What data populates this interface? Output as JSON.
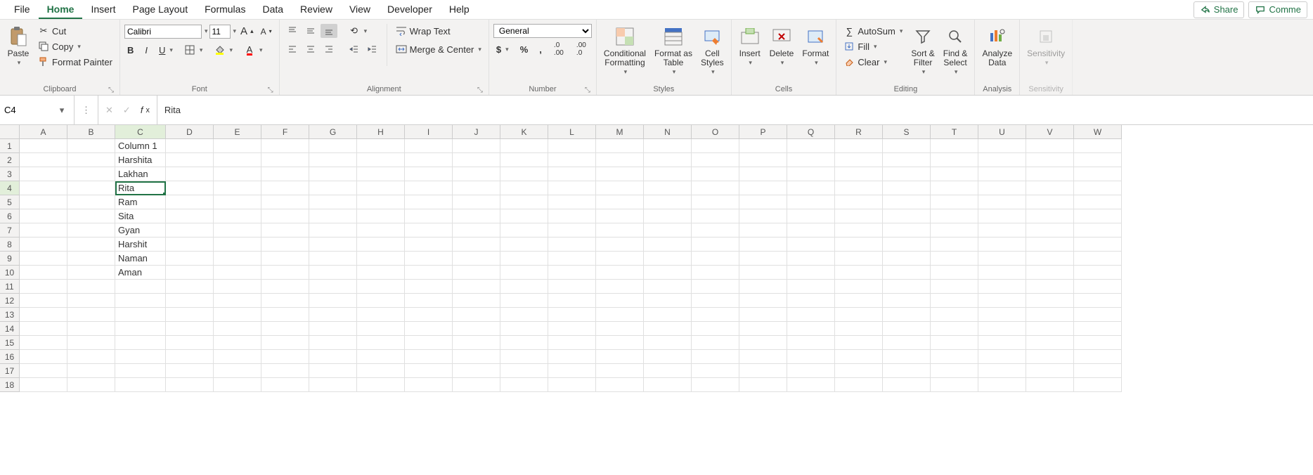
{
  "tabs": [
    "File",
    "Home",
    "Insert",
    "Page Layout",
    "Formulas",
    "Data",
    "Review",
    "View",
    "Developer",
    "Help"
  ],
  "active_tab": "Home",
  "share": "Share",
  "comments": "Comme",
  "clipboard": {
    "label": "Clipboard",
    "paste": "Paste",
    "cut": "Cut",
    "copy": "Copy",
    "fmt": "Format Painter"
  },
  "font": {
    "label": "Font",
    "name": "Calibri",
    "size": "11"
  },
  "alignment": {
    "label": "Alignment",
    "wrap": "Wrap Text",
    "merge": "Merge & Center"
  },
  "number": {
    "label": "Number",
    "format": "General"
  },
  "styles": {
    "label": "Styles",
    "cond": "Conditional\nFormatting",
    "table": "Format as\nTable",
    "cell": "Cell\nStyles"
  },
  "cells_grp": {
    "label": "Cells",
    "insert": "Insert",
    "delete": "Delete",
    "format": "Format"
  },
  "editing": {
    "label": "Editing",
    "sum": "AutoSum",
    "fill": "Fill",
    "clear": "Clear",
    "sort": "Sort &\nFilter",
    "find": "Find &\nSelect"
  },
  "analysis": {
    "label": "Analysis",
    "analyze": "Analyze\nData"
  },
  "sensitivity": {
    "label": "Sensitivity",
    "btn": "Sensitivity"
  },
  "namebox": "C4",
  "formula": "Rita",
  "columns": [
    "A",
    "B",
    "C",
    "D",
    "E",
    "F",
    "G",
    "H",
    "I",
    "J",
    "K",
    "L",
    "M",
    "N",
    "O",
    "P",
    "Q",
    "R",
    "S",
    "T",
    "U",
    "V",
    "W"
  ],
  "rowcount": 18,
  "selected": {
    "row": 4,
    "col": "C"
  },
  "cells_data": {
    "C1": "Column 1",
    "C2": "Harshita",
    "C3": "Lakhan",
    "C4": "Rita",
    "C5": "Ram",
    "C6": "Sita",
    "C7": "Gyan",
    "C8": "Harshit",
    "C9": "Naman",
    "C10": "Aman"
  }
}
